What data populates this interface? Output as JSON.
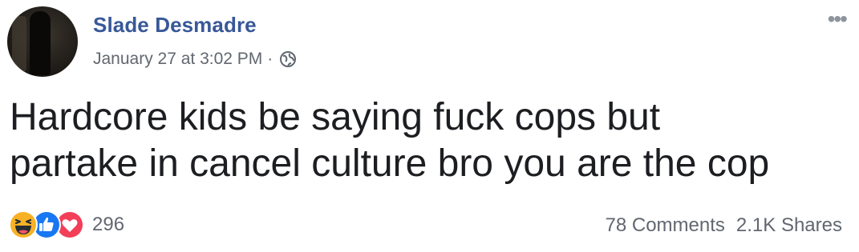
{
  "post": {
    "author": "Slade Desmadre",
    "timestamp": "January 27 at 3:02 PM",
    "separator": "·",
    "privacy_icon": "globe-icon",
    "more_icon": "more-options-icon",
    "text_line1": "Hardcore kids be saying fuck cops but",
    "text_line2": "partake in cancel culture bro you are the cop"
  },
  "reactions": {
    "icons": [
      "haha-reaction-icon",
      "like-reaction-icon",
      "love-reaction-icon"
    ],
    "count": "296"
  },
  "stats": {
    "comments": "78 Comments",
    "shares": "2.1K Shares"
  },
  "colors": {
    "author": "#385898",
    "meta": "#616770",
    "text": "#1c1e21",
    "like_blue": "#1877f2",
    "love_red": "#f33e58",
    "haha_yellow": "#f7b125"
  }
}
